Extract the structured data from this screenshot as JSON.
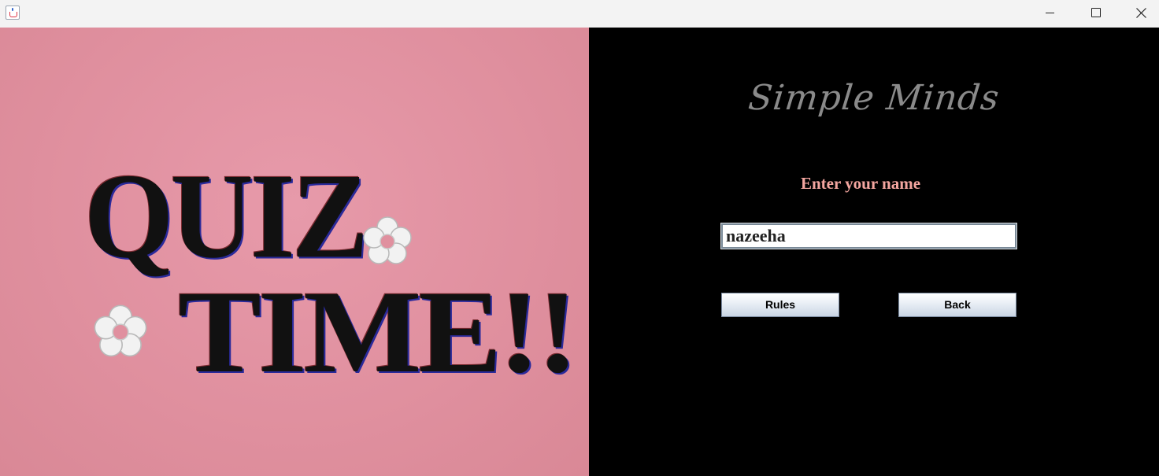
{
  "window": {
    "app_icon": "java-cup-icon",
    "controls": [
      "minimize-icon",
      "maximize-icon",
      "close-icon"
    ]
  },
  "banner": {
    "line1": "QUIZ",
    "line2": "TIME!!",
    "decoration": "flower-icon",
    "background_color": "#e0909f"
  },
  "brand": {
    "title": "Simple Minds",
    "color": "#8a8a8a"
  },
  "form": {
    "name_label": "Enter your name",
    "label_color": "#f4a6a0",
    "name_value": "nazeeha",
    "rules_button": "Rules",
    "back_button": "Back"
  }
}
